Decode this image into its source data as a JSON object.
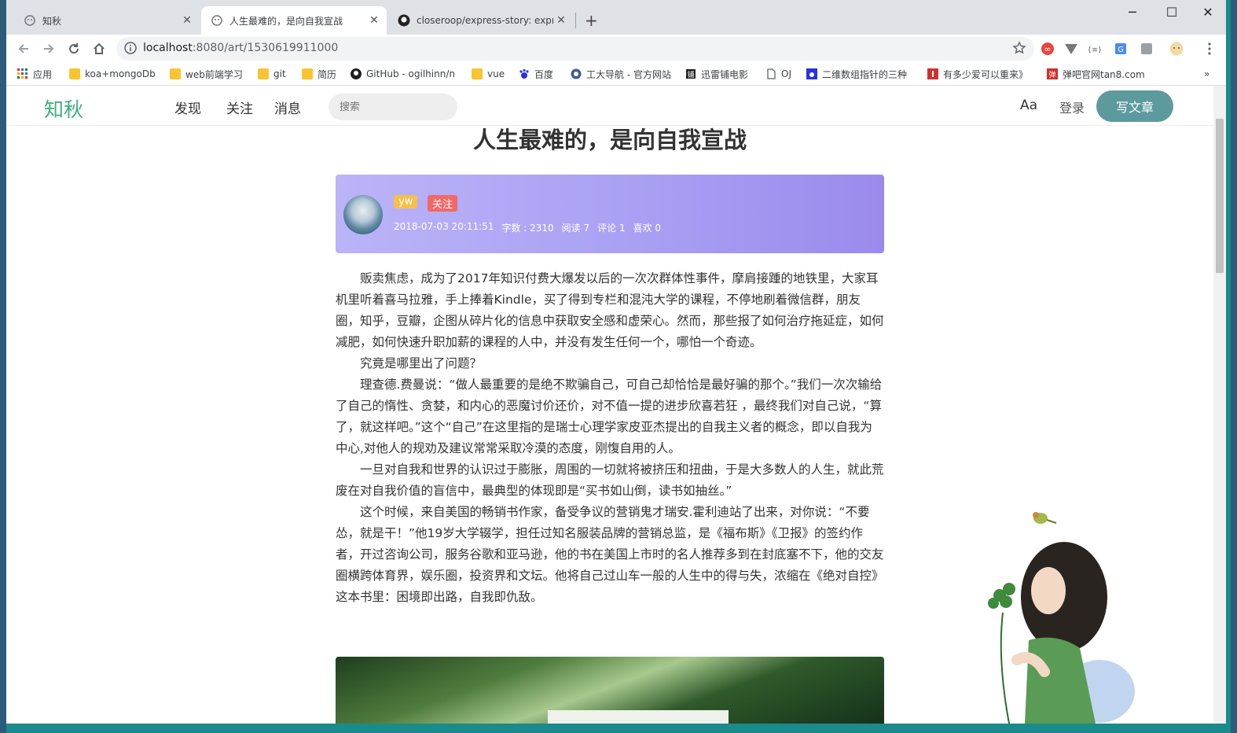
{
  "tabs": [
    {
      "title": "知秋",
      "active": false
    },
    {
      "title": "人生最难的，是向自我宣战",
      "active": true
    },
    {
      "title": "closeroop/express-story: expr",
      "active": false
    }
  ],
  "address": {
    "host": "localhost",
    "path": ":8080/art/1530619911000"
  },
  "bookmarks": [
    "应用",
    "koa+mongoDb",
    "web前端学习",
    "git",
    "简历",
    "GitHub - ogilhinn/n",
    "vue",
    "百度",
    "工大导航 - 官方网站",
    "迅雷铺电影",
    "OJ",
    "二维数组指针的三种",
    "有多少爱可以重来》",
    "弹吧官网tan8.com"
  ],
  "bookmarks_more": "»",
  "site": {
    "logo": "知秋",
    "nav": [
      "发现",
      "关注",
      "消息"
    ],
    "search_placeholder": "搜索",
    "aa": "Aa",
    "login": "登录",
    "write": "写文章"
  },
  "article": {
    "title": "人生最难的，是向自我宣战",
    "author": "yw",
    "follow": "关注",
    "meta": [
      "2018-07-03 20:11:51",
      "字数 : 2310",
      "阅读 7",
      "评论 1",
      "喜欢 0"
    ],
    "paragraphs": [
      "贩卖焦虑，成为了2017年知识付费大爆发以后的一次次群体性事件，摩肩接踵的地铁里，大家耳机里听着喜马拉雅，手上捧着Kindle，买了得到专栏和混沌大学的课程，不停地刷着微信群，朋友圈，知乎，豆瓣，企图从碎片化的信息中获取安全感和虚荣心。然而，那些报了如何治疗拖延症，如何减肥，如何快速升职加薪的课程的人中，并没有发生任何一个，哪怕一个奇迹。",
      "究竟是哪里出了问题？",
      "理查德.费曼说：“做人最重要的是绝不欺骗自己，可自己却恰恰是最好骗的那个。”我们一次次输给了自己的惰性、贪婪，和内心的恶魔讨价还价，对不值一提的进步欣喜若狂 ，最终我们对自己说，“算了，就这样吧。”这个“自己”在这里指的是瑞士心理学家皮亚杰提出的自我主义者的概念，即以自我为中心,对他人的规劝及建议常常采取冷漠的态度，刚愎自用的人。",
      "一旦对自我和世界的认识过于膨胀，周围的一切就将被挤压和扭曲，于是大多数人的人生，就此荒废在对自我价值的盲信中，最典型的体现即是“买书如山倒，读书如抽丝。”",
      "这个时候，来自美国的畅销书作家，备受争议的营销鬼才瑞安.霍利迪站了出来，对你说：“不要怂，就是干！”他19岁大学辍学，担任过知名服装品牌的营销总监，是《福布斯》《卫报》的签约作者，开过咨询公司，服务谷歌和亚马逊，他的书在美国上市时的名人推荐多到在封底塞不下，他的交友圈横跨体育界，娱乐圈，投资界和文坛。他将自己过山车一般的人生中的得与失，浓缩在《绝对自控》这本书里：困境即出路，自我即仇敌。"
    ]
  },
  "colors": {
    "brand": "#3eaf7c",
    "write_button": "#5d9a9d",
    "tag_author": "#f7c04a",
    "tag_follow": "#f26767"
  }
}
